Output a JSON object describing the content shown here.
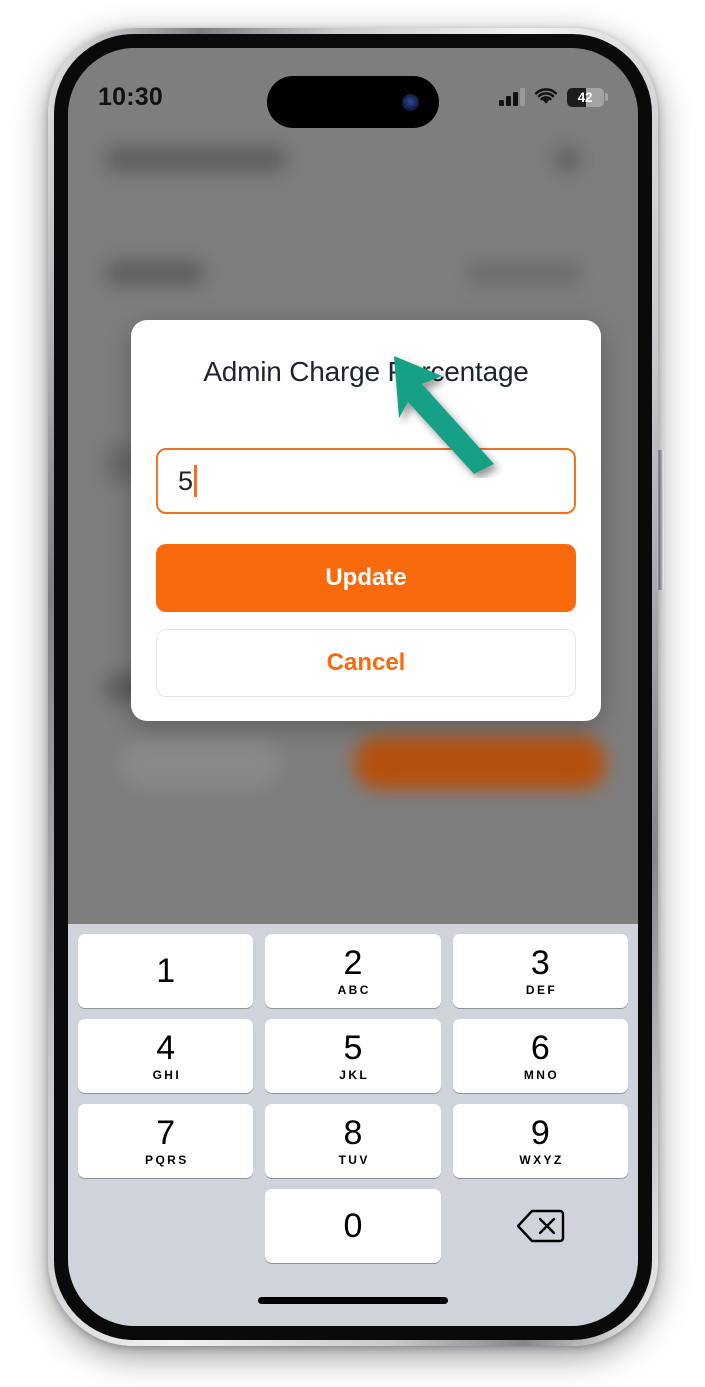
{
  "status_bar": {
    "time": "10:30",
    "signal_icon": "cellular-signal-icon",
    "wifi_icon": "wifi-icon",
    "battery_level": "42",
    "battery_icon": "battery-icon",
    "face_id_icon": "face-id-sensor-icon"
  },
  "dialog": {
    "title": "Admin Charge Percentage",
    "input": {
      "value": "5",
      "placeholder": ""
    },
    "update_label": "Update",
    "cancel_label": "Cancel"
  },
  "keyboard": {
    "rows": [
      [
        {
          "digit": "1",
          "letters": ""
        },
        {
          "digit": "2",
          "letters": "ABC"
        },
        {
          "digit": "3",
          "letters": "DEF"
        }
      ],
      [
        {
          "digit": "4",
          "letters": "GHI"
        },
        {
          "digit": "5",
          "letters": "JKL"
        },
        {
          "digit": "6",
          "letters": "MNO"
        }
      ],
      [
        {
          "digit": "7",
          "letters": "PQRS"
        },
        {
          "digit": "8",
          "letters": "TUV"
        },
        {
          "digit": "9",
          "letters": "WXYZ"
        }
      ],
      [
        {
          "digit": "",
          "letters": ""
        },
        {
          "digit": "0",
          "letters": ""
        },
        {
          "digit": "",
          "letters": "",
          "icon": "backspace-icon"
        }
      ]
    ]
  },
  "cursor": {
    "icon": "arrow-pointer-icon",
    "color": "#14a085"
  },
  "colors": {
    "accent_orange": "#f96a0d",
    "input_border": "#f4711f",
    "title_text": "#1d2433",
    "keyboard_bg": "#ced3dc",
    "dimmed_backdrop": "#7e7e7e",
    "cursor_green": "#14a085"
  }
}
